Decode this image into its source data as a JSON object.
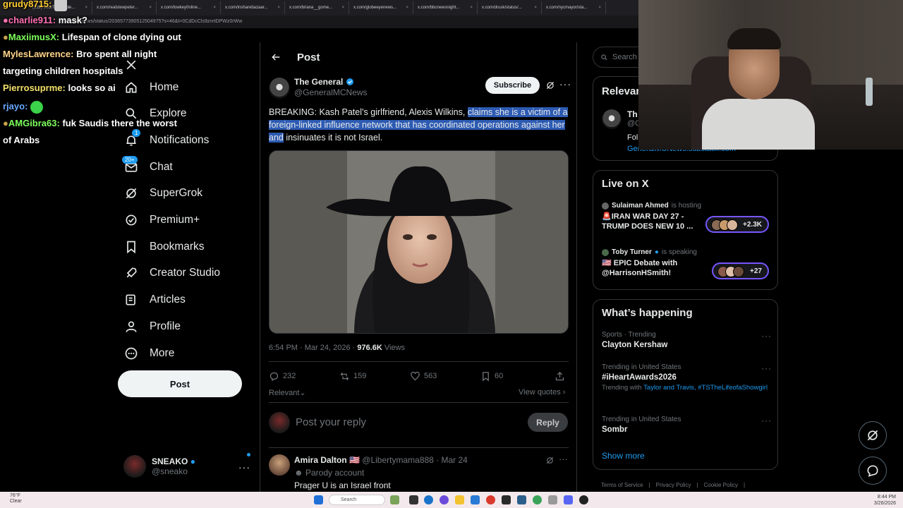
{
  "browser": {
    "tabs": [
      "(128) JackTheRipple...",
      "x.com/realstewpeter...",
      "x.com/lowkey0nline...",
      "x.com/insharebazaar...",
      "x.com/briana__gome...",
      "x.com/globeeyenews...",
      "x.com/bbcnewsnight...",
      "x.com/drusk/status/...",
      "x.com/nycmayor/sta..."
    ],
    "url": "x.com/news/status/2036577390512504975?s=46&t=0CdDcCls9znrtDPWz0rWw"
  },
  "chat": [
    {
      "user": "grudy8715:",
      "msg": "",
      "color": "#ffcc33"
    },
    {
      "user": "charlie911:",
      "msg": "mask?",
      "color": "#ff6fb4"
    },
    {
      "user": "MaxiimusX:",
      "msg": "Lifespan of clone dying out",
      "color": "#7cff5a"
    },
    {
      "user": "MylesLawrence:",
      "msg": "Bro spent all night",
      "msg2": "targeting children hospitals",
      "color": "#ffd48a"
    },
    {
      "user": "Pierrosuprme:",
      "msg": "looks so ai",
      "color": "#f3e06a"
    },
    {
      "user": "rjayo:",
      "msg": "",
      "color": "#66a8ff"
    },
    {
      "user": "AMGibra63:",
      "msg": "fuk Saudis there the worst",
      "msg2": "of Arabs",
      "color": "#7cff5a"
    }
  ],
  "nav": {
    "items": [
      {
        "label": "Home",
        "icon": "home-icon"
      },
      {
        "label": "Explore",
        "icon": "search-icon"
      },
      {
        "label": "Notifications",
        "icon": "bell-icon",
        "badge": "1"
      },
      {
        "label": "Chat",
        "icon": "mail-icon",
        "badge": "20+"
      },
      {
        "label": "SuperGrok",
        "icon": "grok-icon"
      },
      {
        "label": "Premium+",
        "icon": "verified-icon"
      },
      {
        "label": "Bookmarks",
        "icon": "bookmark-icon"
      },
      {
        "label": "Creator Studio",
        "icon": "rocket-icon"
      },
      {
        "label": "Articles",
        "icon": "articles-icon"
      },
      {
        "label": "Profile",
        "icon": "person-icon"
      },
      {
        "label": "More",
        "icon": "more-circle-icon"
      }
    ],
    "post_label": "Post",
    "account": {
      "name": "SNEAKO",
      "handle": "@sneako"
    }
  },
  "main": {
    "header_title": "Post",
    "tweet": {
      "author_name": "The General",
      "author_handle": "@GeneralMCNews",
      "subscribe_label": "Subscribe",
      "text_plain": "BREAKING: Kash Patel’s girlfriend, Alexis Wilkins, ",
      "text_highlight": "claims she is a victim of a foreign-linked influence network that has coordinated operations against her and",
      "text_tail": " insinuates it is not Israel.",
      "time": "6:54 PM · Mar 24, 2026 · ",
      "views_count": "976.6K",
      "views_label": " Views",
      "replies": "232",
      "reposts": "159",
      "likes": "563",
      "bookmarks": "60",
      "sort_label": "Relevant",
      "view_quotes": "View quotes"
    },
    "reply_placeholder": "Post your reply",
    "reply_button": "Reply",
    "reply": {
      "name": "Amira Dalton 🇺🇸",
      "handle_date": " @Libertymama888 · Mar 24",
      "parody": "Parody account",
      "text": "Prager U is an Israel front"
    }
  },
  "right": {
    "search_placeholder": "Search",
    "relevant_title": "Relevant people",
    "relevant_name": "Th",
    "relevant_handle": "@G",
    "relevant_bio": "Fol",
    "relevant_link": "GeneralMCNews.substack.com",
    "live_title": "Live on X",
    "live": [
      {
        "host": "Sulaiman Ahmed",
        "status": "is hosting",
        "title": "🚨IRAN WAR DAY 27 - TRUMP DOES NEW 10 ...",
        "count": "+2.3K"
      },
      {
        "host": "Toby Turner",
        "status": "is speaking",
        "title": "🇺🇸 EPIC Debate with @HarrisonHSmith!",
        "count": "+27"
      }
    ],
    "happening_title": "What’s happening",
    "trends": [
      {
        "category": "Sports · Trending",
        "name": "Clayton Kershaw",
        "sub": ""
      },
      {
        "category": "Trending in United States",
        "name": "#iHeartAwards2026",
        "sub_prefix": "Trending with ",
        "sub_links": "Taylor and Travis, #TSTheLifeofaShowgirl"
      },
      {
        "category": "Trending in United States",
        "name": "Sombr",
        "sub": ""
      }
    ],
    "show_more": "Show more",
    "footer": [
      "Terms of Service",
      "|",
      "Privacy Policy",
      "|",
      "Cookie Policy",
      "|"
    ]
  },
  "taskbar": {
    "weather_temp": "76°F",
    "weather_desc": "Clear",
    "search": "Search",
    "time": "8:44 PM",
    "date": "3/26/2026"
  },
  "colors": {
    "accent": "#1d9bf0",
    "highlight": "#2d5bb3",
    "live_pill": "#7856ff"
  }
}
